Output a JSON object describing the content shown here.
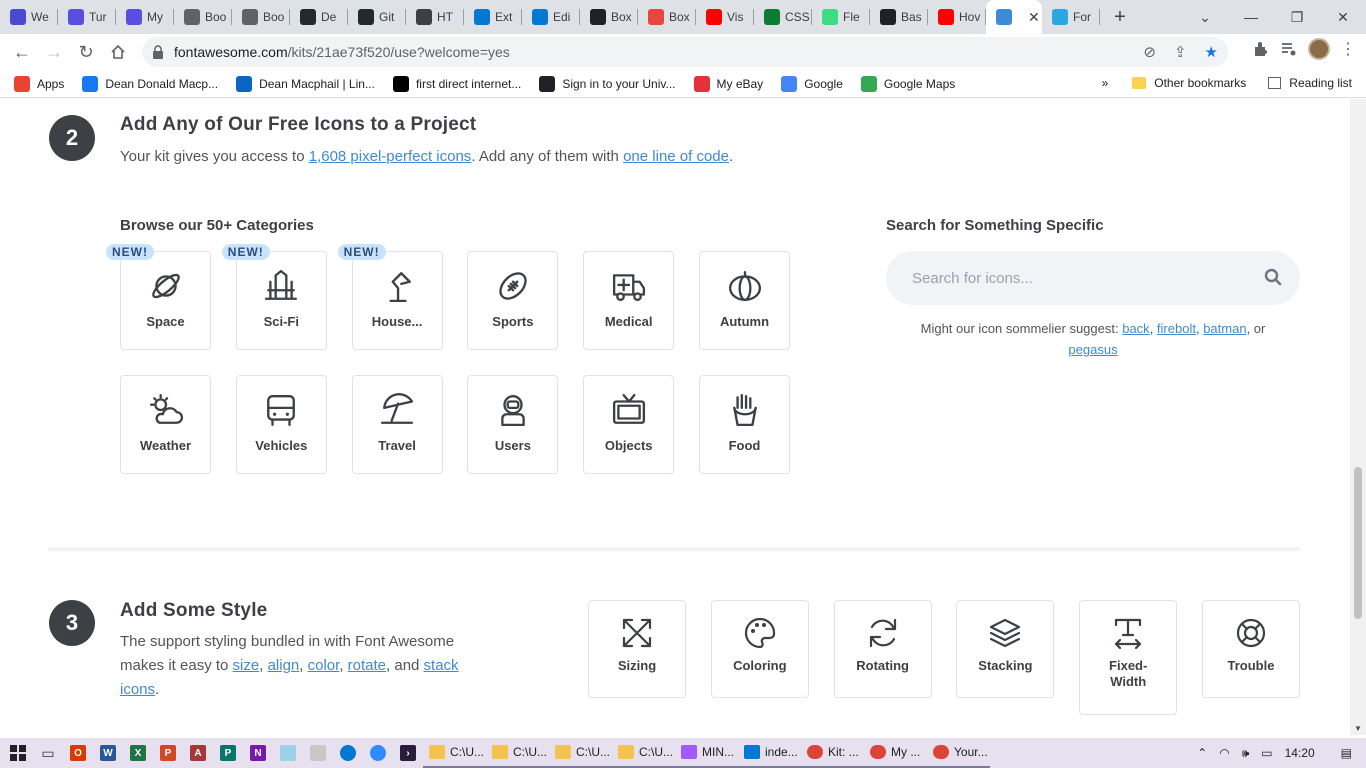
{
  "browser": {
    "tabs": [
      {
        "label": "We",
        "icon": "w-purple",
        "color": "#4a4ad0"
      },
      {
        "label": "Tur",
        "icon": "d-purple",
        "color": "#5a4ee0"
      },
      {
        "label": "My",
        "icon": "d-purple",
        "color": "#5a4ee0"
      },
      {
        "label": "Boo",
        "icon": "globe",
        "color": "#5f6368"
      },
      {
        "label": "Boo",
        "icon": "globe",
        "color": "#5f6368"
      },
      {
        "label": "De",
        "icon": "github",
        "color": "#24292e"
      },
      {
        "label": "Git",
        "icon": "github",
        "color": "#24292e"
      },
      {
        "label": "HT",
        "icon": "shield",
        "color": "#3c4043"
      },
      {
        "label": "Ext",
        "icon": "vscode",
        "color": "#0078d4"
      },
      {
        "label": "Edi",
        "icon": "vscode",
        "color": "#0078d4"
      },
      {
        "label": "Box",
        "icon": "codepen",
        "color": "#202124"
      },
      {
        "label": "Box",
        "icon": "asterisk",
        "color": "#e8453c"
      },
      {
        "label": "Vis",
        "icon": "youtube",
        "color": "#ff0000"
      },
      {
        "label": "CSS",
        "icon": "w-green",
        "color": "#0a7d32"
      },
      {
        "label": "Fle",
        "icon": "android",
        "color": "#3ddc84"
      },
      {
        "label": "Bas",
        "icon": "bas",
        "color": "#202124"
      },
      {
        "label": "Hov",
        "icon": "youtube",
        "color": "#ff0000"
      },
      {
        "label": "",
        "icon": "flag",
        "color": "#3d8ad7",
        "active": true
      },
      {
        "label": "For",
        "icon": "b-blue",
        "color": "#2aa6e0"
      }
    ],
    "url_host": "fontawesome.com",
    "url_path": "/kits/21ae73f520/use?welcome=yes",
    "bookmarks": [
      {
        "label": "Apps",
        "icon": "apps",
        "color": "#ea4335"
      },
      {
        "label": "Dean Donald Macp...",
        "icon": "facebook",
        "color": "#1877f2"
      },
      {
        "label": "Dean Macphail | Lin...",
        "icon": "linkedin",
        "color": "#0a66c2"
      },
      {
        "label": "first direct internet...",
        "icon": "fd",
        "color": "#000000"
      },
      {
        "label": "Sign in to your Univ...",
        "icon": "crest",
        "color": "#202124"
      },
      {
        "label": "My eBay",
        "icon": "bag",
        "color": "#e53238"
      },
      {
        "label": "Google",
        "icon": "google",
        "color": "#4285f4"
      },
      {
        "label": "Google Maps",
        "icon": "pin",
        "color": "#34a853"
      }
    ],
    "other_bookmarks": "Other bookmarks",
    "reading_list": "Reading list",
    "overflow": "»"
  },
  "step2": {
    "number": "2",
    "title": "Add Any of Our Free Icons to a Project",
    "text_before": "Your kit gives you access to ",
    "link_icons": "1,608 pixel-perfect icons",
    "text_middle": ". Add any of them with ",
    "link_code": "one line of code",
    "text_after": ".",
    "categories_heading": "Browse our 50+ Categories",
    "badge_new": "NEW!",
    "categories": [
      {
        "label": "Space",
        "icon": "planet-icon",
        "new": true
      },
      {
        "label": "Sci-Fi",
        "icon": "starship-icon",
        "new": true
      },
      {
        "label": "House...",
        "icon": "lamp-icon",
        "new": true
      },
      {
        "label": "Sports",
        "icon": "football-icon",
        "new": false
      },
      {
        "label": "Medical",
        "icon": "ambulance-icon",
        "new": false
      },
      {
        "label": "Autumn",
        "icon": "pumpkin-icon",
        "new": false
      },
      {
        "label": "Weather",
        "icon": "sun-cloud-icon",
        "new": false
      },
      {
        "label": "Vehicles",
        "icon": "bus-icon",
        "new": false
      },
      {
        "label": "Travel",
        "icon": "umbrella-beach-icon",
        "new": false
      },
      {
        "label": "Users",
        "icon": "astronaut-icon",
        "new": false
      },
      {
        "label": "Objects",
        "icon": "tv-icon",
        "new": false
      },
      {
        "label": "Food",
        "icon": "fries-icon",
        "new": false
      }
    ],
    "search_heading": "Search for Something Specific",
    "search_placeholder": "Search for icons...",
    "suggest_prefix": "Might our icon sommelier suggest: ",
    "suggestions": [
      "back",
      "firebolt",
      "batman",
      "pegasus"
    ],
    "suggest_sep1": ", ",
    "suggest_sep2": ", ",
    "suggest_or": ", or"
  },
  "step3": {
    "number": "3",
    "title": "Add Some Style",
    "text_1": "The support styling bundled in with Font Awesome makes it easy to ",
    "links": [
      "size",
      "align",
      "color",
      "rotate",
      "stack icons"
    ],
    "sep_1": ", ",
    "sep_2": ", ",
    "sep_3": ", ",
    "sep_and": ", and ",
    "text_end": ".",
    "styles": [
      {
        "label": "Sizing",
        "icon": "expand-arrows-icon"
      },
      {
        "label": "Coloring",
        "icon": "palette-icon"
      },
      {
        "label": "Rotating",
        "icon": "rotate-icon"
      },
      {
        "label": "Stacking",
        "icon": "layers-icon"
      },
      {
        "label": "Fixed-Width",
        "icon": "text-width-icon"
      },
      {
        "label": "Trouble",
        "icon": "life-ring-icon"
      }
    ]
  },
  "taskbar": {
    "windows": [
      {
        "label": "C:\\U...",
        "icon": "folder"
      },
      {
        "label": "C:\\U...",
        "icon": "folder"
      },
      {
        "label": "C:\\U...",
        "icon": "folder"
      },
      {
        "label": "C:\\U...",
        "icon": "folder"
      },
      {
        "label": "MIN...",
        "icon": "figma"
      },
      {
        "label": "inde...",
        "icon": "vscode"
      },
      {
        "label": "Kit: ...",
        "icon": "chrome"
      },
      {
        "label": "My ...",
        "icon": "chrome"
      },
      {
        "label": "Your...",
        "icon": "chrome"
      }
    ],
    "time": "14:20"
  }
}
